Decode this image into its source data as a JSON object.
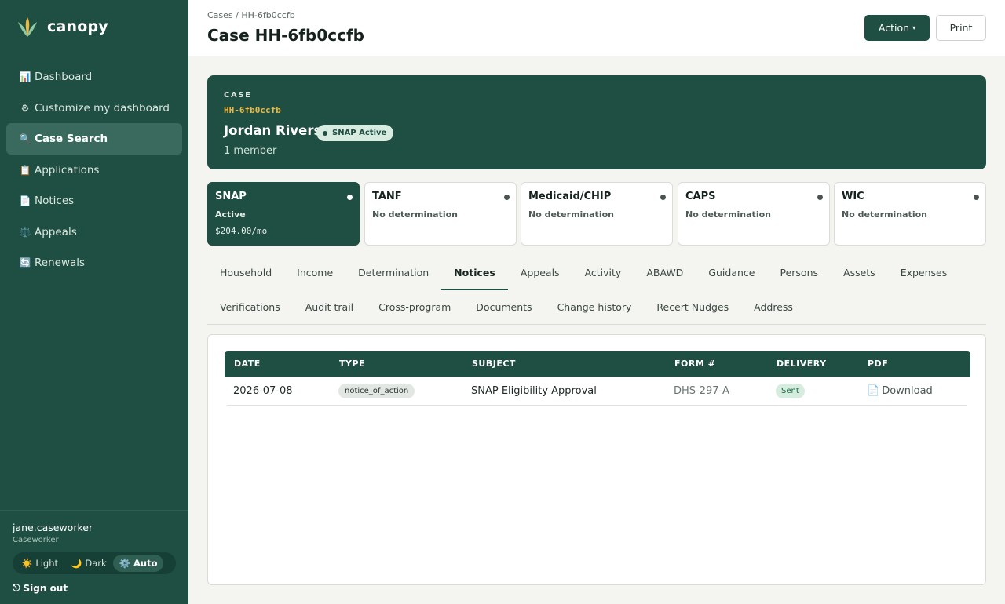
{
  "sidebar": {
    "brand": "canopy",
    "nav": [
      {
        "icon": "📊",
        "label": "Dashboard"
      },
      {
        "icon": "⚙",
        "label": "Customize my dashboard"
      },
      {
        "icon": "🔍",
        "label": "Case Search"
      },
      {
        "icon": "📋",
        "label": "Applications"
      },
      {
        "icon": "📄",
        "label": "Notices"
      },
      {
        "icon": "⚖️",
        "label": "Appeals"
      },
      {
        "icon": "🔄",
        "label": "Renewals"
      }
    ],
    "active_item": "Case Search",
    "user": {
      "name": "jane.caseworker",
      "role": "Caseworker"
    },
    "theme": [
      {
        "icon": "☀️",
        "label": "Light"
      },
      {
        "icon": "🌙",
        "label": "Dark"
      },
      {
        "icon": "⚙️",
        "label": "Auto"
      }
    ],
    "theme_selected": "Auto",
    "signout": {
      "icon": "⎋",
      "label": "Sign out"
    }
  },
  "header": {
    "breadcrumb_root": "Cases",
    "breadcrumb_sep": " / ",
    "breadcrumb_current": "HH-6fb0ccfb",
    "title": "Case HH-6fb0ccfb",
    "action_label": "Action",
    "action_caret": "▾",
    "print_label": "Print"
  },
  "case": {
    "label": "CASE",
    "code": "HH-6fb0ccfb",
    "name": "Jordan Rivers",
    "badge": "SNAP Active",
    "members": "1 member"
  },
  "programs": [
    {
      "name": "SNAP",
      "status": "Active",
      "amount": "$204.00/mo"
    },
    {
      "name": "TANF",
      "status": "No determination",
      "amount": ""
    },
    {
      "name": "Medicaid/CHIP",
      "status": "No determination",
      "amount": ""
    },
    {
      "name": "CAPS",
      "status": "No determination",
      "amount": ""
    },
    {
      "name": "WIC",
      "status": "No determination",
      "amount": ""
    }
  ],
  "active_program": "SNAP",
  "tabs": {
    "row1": [
      "Household",
      "Income",
      "Determination",
      "Notices",
      "Appeals",
      "Activity",
      "ABAWD",
      "Guidance",
      "Persons",
      "Assets",
      "Expenses"
    ],
    "row2": [
      "Verifications",
      "Audit trail",
      "Cross-program",
      "Documents",
      "Change history",
      "Recert Nudges",
      "Address"
    ],
    "active": "Notices"
  },
  "notices": {
    "columns": [
      "DATE",
      "TYPE",
      "SUBJECT",
      "FORM #",
      "DELIVERY",
      "PDF"
    ],
    "rows": [
      {
        "date": "2026-07-08",
        "type": "notice_of_action",
        "subject": "SNAP Eligibility Approval",
        "form": "DHS-297-A",
        "delivery": "Sent",
        "pdf_icon": "📄",
        "pdf": "Download"
      }
    ]
  },
  "colors": {
    "brand": "#1f4f43",
    "accent_code": "#e8b949",
    "sent": "#1d6b45",
    "background": "#f4f5f1"
  }
}
